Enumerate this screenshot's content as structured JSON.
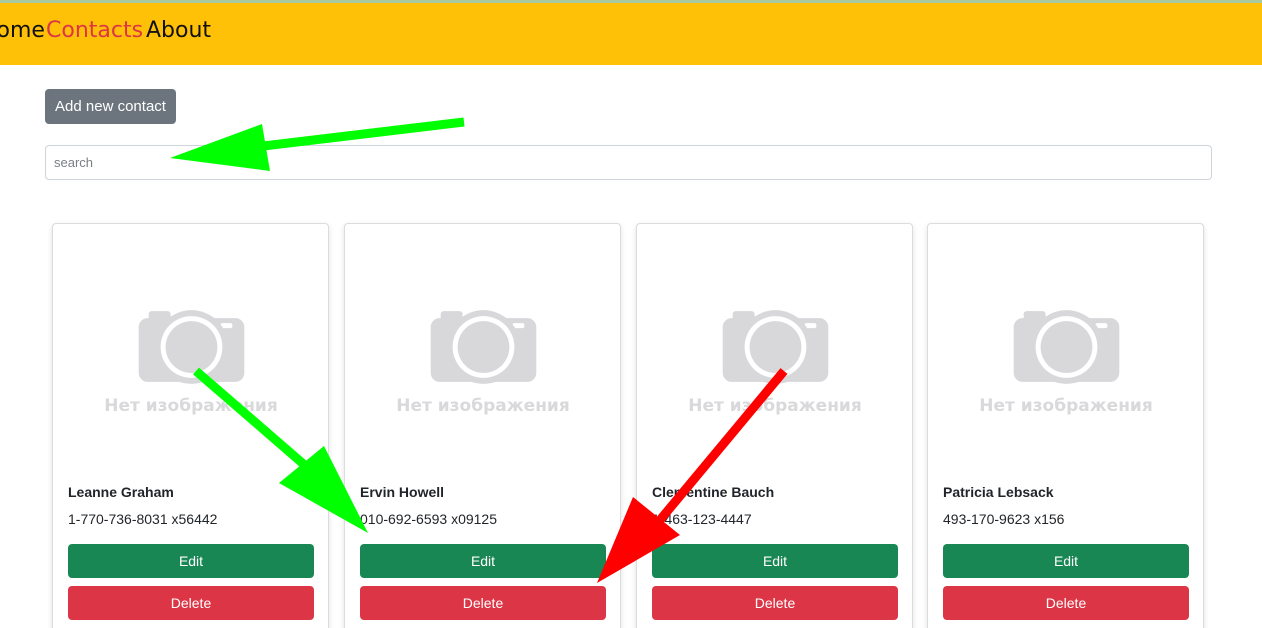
{
  "nav": {
    "home_label": "Home",
    "contacts_label": "Contacts",
    "about_label": "About"
  },
  "toolbar": {
    "add_label": "Add new contact"
  },
  "search": {
    "placeholder": "search",
    "value": ""
  },
  "no_image_text": "Нет изображения",
  "contacts": [
    {
      "name": "Leanne Graham",
      "phone": "1-770-736-8031 x56442",
      "edit_label": "Edit",
      "delete_label": "Delete"
    },
    {
      "name": "Ervin Howell",
      "phone": "010-692-6593 x09125",
      "edit_label": "Edit",
      "delete_label": "Delete"
    },
    {
      "name": "Clementine Bauch",
      "phone": "1-463-123-4447",
      "edit_label": "Edit",
      "delete_label": "Delete"
    },
    {
      "name": "Patricia Lebsack",
      "phone": "493-170-9623 x156",
      "edit_label": "Edit",
      "delete_label": "Delete"
    }
  ],
  "colors": {
    "navbar": "#ffc107",
    "active_nav": "#dc3545",
    "add_button": "#6c757d",
    "edit_button": "#198754",
    "delete_button": "#dc3545",
    "arrow_green": "#00ff00",
    "arrow_red": "#ff0000"
  },
  "annotations": [
    {
      "type": "arrow",
      "color": "green",
      "points_to": "search-input"
    },
    {
      "type": "arrow",
      "color": "green",
      "points_to": "edit-button"
    },
    {
      "type": "arrow",
      "color": "red",
      "points_to": "delete-button"
    }
  ]
}
